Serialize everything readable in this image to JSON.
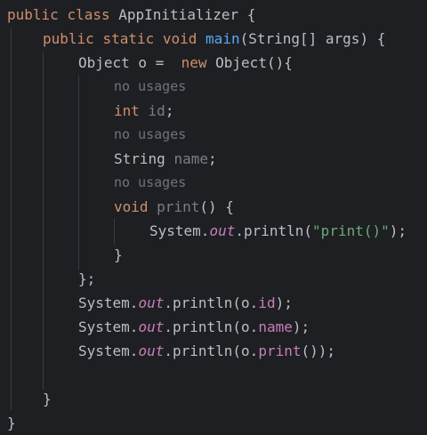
{
  "code": {
    "l1": {
      "kw1": "public",
      "kw2": "class",
      "name": "AppInitializer",
      "brace": "{"
    },
    "l2": {
      "kw1": "public",
      "kw2": "static",
      "kw3": "void",
      "method": "main",
      "params": "(String[] args) {"
    },
    "l3": {
      "type": "Object",
      "decl": " o = ",
      "kw": "new",
      "ctor": " Object(){"
    },
    "l4": {
      "hint": "no usages"
    },
    "l5": {
      "kw": "int",
      "field": "id",
      "end": ";"
    },
    "l6": {
      "hint": "no usages"
    },
    "l7": {
      "type": "String",
      "field": "name",
      "end": ";"
    },
    "l8": {
      "hint": "no usages"
    },
    "l9": {
      "kw": "void",
      "method": "print",
      "end": "() {"
    },
    "l10": {
      "pre": "System.",
      "static": "out",
      "mid": ".println(",
      "str": "\"print()\"",
      "end": ");"
    },
    "l11": {
      "text": "}"
    },
    "l12": {
      "text": "};"
    },
    "l13": {
      "pre": "System.",
      "static": "out",
      "mid": ".println(o.",
      "field": "id",
      "end": ");"
    },
    "l14": {
      "pre": "System.",
      "static": "out",
      "mid": ".println(o.",
      "field": "name",
      "end": ");"
    },
    "l15": {
      "pre": "System.",
      "static": "out",
      "mid": ".println(o.",
      "field": "print",
      "end": "());"
    },
    "l17": {
      "text": "}"
    },
    "l18": {
      "text": "}"
    }
  },
  "colors": {
    "background": "#1e1f22",
    "keyword": "#cf8e6d",
    "method": "#56a8f5",
    "field": "#c77dbb",
    "string": "#6aab73",
    "hint": "#6f737a"
  }
}
